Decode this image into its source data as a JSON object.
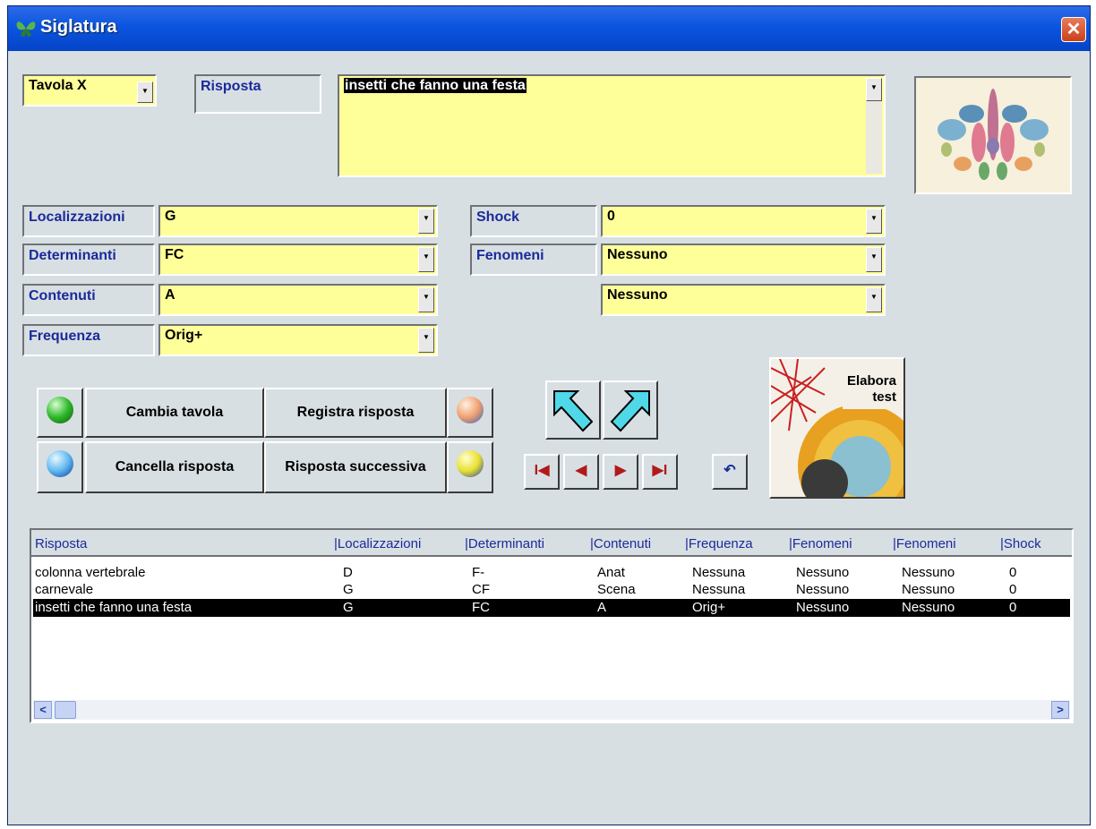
{
  "window": {
    "title": "Siglatura",
    "close_label": "✕"
  },
  "tavola": {
    "value": "Tavola X"
  },
  "risposta": {
    "label": "Risposta",
    "value": "insetti che fanno una festa"
  },
  "fields": {
    "localizzazioni": {
      "label": "Localizzazioni",
      "value": "G"
    },
    "determinanti": {
      "label": "Determinanti",
      "value": "FC"
    },
    "contenuti": {
      "label": "Contenuti",
      "value": "A"
    },
    "frequenza": {
      "label": "Frequenza",
      "value": "Orig+"
    },
    "shock": {
      "label": "Shock",
      "value": "0"
    },
    "fenomeni": {
      "label": "Fenomeni",
      "value": "Nessuno"
    },
    "fenomeni2": {
      "value": "Nessuno"
    }
  },
  "buttons": {
    "cambia_tavola": "Cambia tavola",
    "registra_risposta": "Registra risposta",
    "cancella_risposta": "Cancella risposta",
    "risposta_successiva": "Risposta successiva",
    "elabora_line1": "Elabora",
    "elabora_line2": "test"
  },
  "nav": {
    "first": "I◀",
    "prev": "◀",
    "next": "▶",
    "last": "▶I",
    "undo": "↶"
  },
  "table": {
    "headers": [
      "Risposta",
      "|Localizzazioni",
      "|Determinanti",
      "|Contenuti",
      "|Frequenza",
      "|Fenomeni",
      "|Fenomeni",
      "|Shock"
    ],
    "rows": [
      [
        "colonna vertebrale",
        "D",
        "F-",
        "Anat",
        "Nessuna",
        "Nessuno",
        "Nessuno",
        "0"
      ],
      [
        "carnevale",
        "G",
        "CF",
        "Scena",
        "Nessuna",
        "Nessuno",
        "Nessuno",
        "0"
      ],
      [
        "insetti che fanno una festa",
        "G",
        "FC",
        "A",
        "Orig+",
        "Nessuno",
        "Nessuno",
        "0"
      ]
    ],
    "selected_row": 2
  },
  "icons": {
    "app": "butterfly-icon",
    "inkblot": "inkblot-image",
    "elabora": "gear-chart-icon"
  }
}
